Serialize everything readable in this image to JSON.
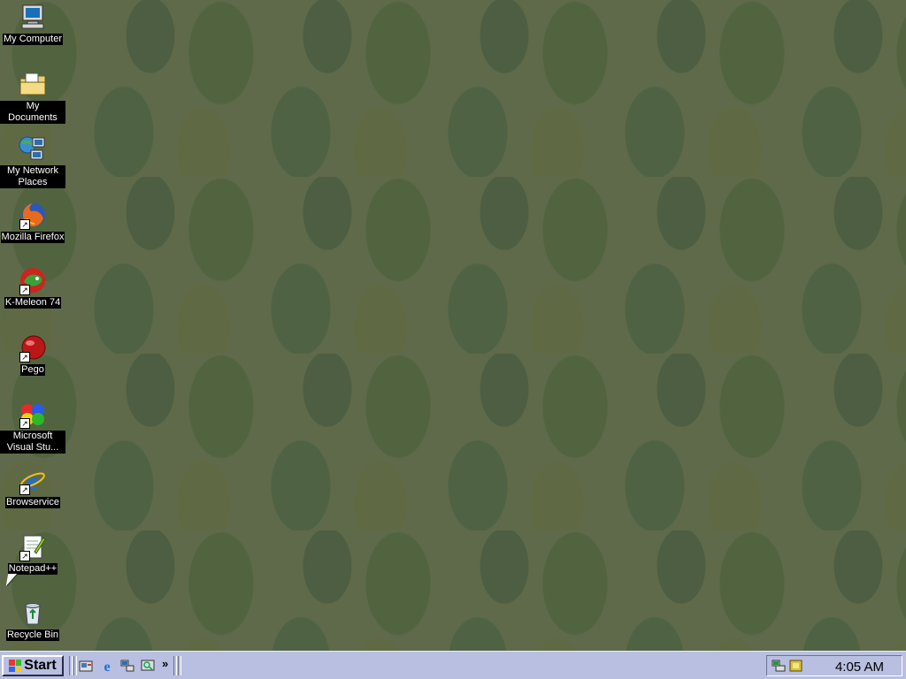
{
  "desktop_icons": [
    {
      "label": "My Computer",
      "icon": "computer-icon",
      "shortcut": false
    },
    {
      "label": "My Documents",
      "icon": "folder-icon",
      "shortcut": false
    },
    {
      "label": "My Network Places",
      "icon": "network-icon",
      "shortcut": false
    },
    {
      "label": "Mozilla Firefox",
      "icon": "firefox-icon",
      "shortcut": true
    },
    {
      "label": "K-Meleon 74",
      "icon": "kmeleon-icon",
      "shortcut": true
    },
    {
      "label": "Pego",
      "icon": "pego-icon",
      "shortcut": true
    },
    {
      "label": "Microsoft Visual Stu...",
      "icon": "visual-studio-icon",
      "shortcut": true
    },
    {
      "label": "Browservice",
      "icon": "internet-explorer-icon",
      "shortcut": true
    },
    {
      "label": "Notepad++",
      "icon": "notepad-icon",
      "shortcut": true
    },
    {
      "label": "Recycle Bin",
      "icon": "recycle-bin-icon",
      "shortcut": false
    }
  ],
  "taskbar": {
    "start_label": "Start",
    "quick_launch_icons": [
      "show-desktop-icon",
      "internet-explorer-icon",
      "network-icon",
      "media-icon"
    ],
    "more_label": "»",
    "tray_icons": [
      "network-status-icon",
      "notification-icon"
    ],
    "clock": "4:05 AM"
  },
  "colors": {
    "desktop_bg": "#5f6a4a",
    "taskbar_bg": "#b8bfe0"
  }
}
